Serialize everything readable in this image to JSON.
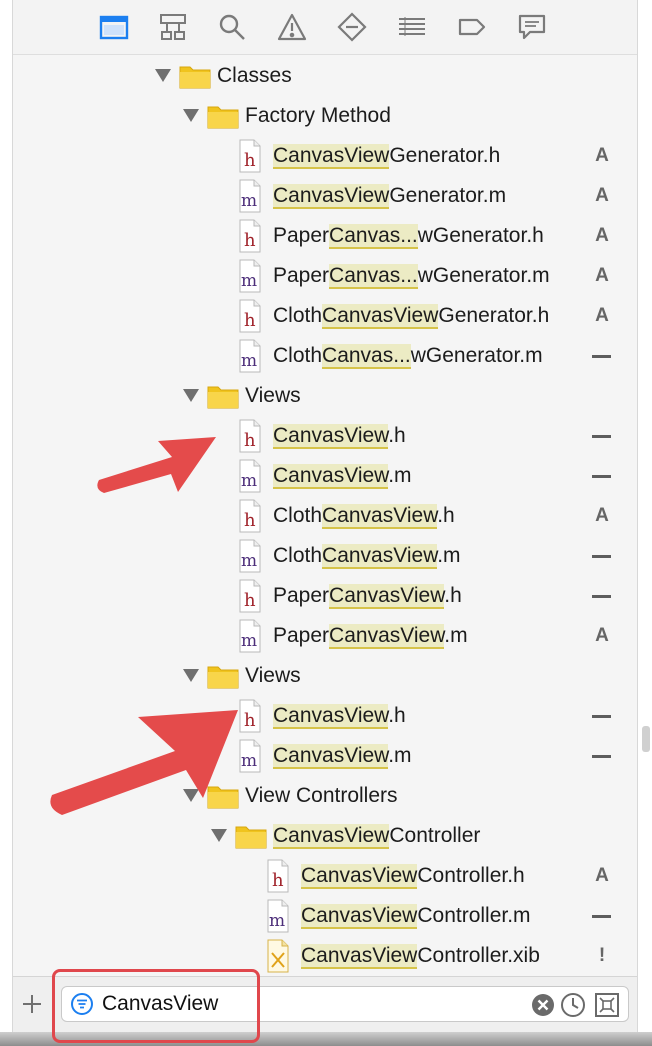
{
  "toolbar": {
    "icons": [
      "folder-icon",
      "hierarchy-icon",
      "search-icon",
      "warning-icon",
      "test-diamond-icon",
      "list-icon",
      "tag-icon",
      "comment-icon"
    ]
  },
  "tree": [
    {
      "kind": "folder",
      "label": "Classes"
    },
    {
      "kind": "folder",
      "label": "Factory Method"
    },
    {
      "kind": "file",
      "type": "h",
      "pre": "",
      "match": "CanvasView",
      "post": "Generator.h",
      "status": "A"
    },
    {
      "kind": "file",
      "type": "m",
      "pre": "",
      "match": "CanvasView",
      "post": "Generator.m",
      "status": "A"
    },
    {
      "kind": "file",
      "type": "h",
      "pre": "Paper",
      "match": "Canvas...",
      "post": "wGenerator.h",
      "status": "A"
    },
    {
      "kind": "file",
      "type": "m",
      "pre": "Paper",
      "match": "Canvas...",
      "post": "wGenerator.m",
      "status": "A"
    },
    {
      "kind": "file",
      "type": "h",
      "pre": "Cloth",
      "match": "CanvasView",
      "post": "Generator.h",
      "status": "A"
    },
    {
      "kind": "file",
      "type": "m",
      "pre": "Cloth",
      "match": "Canvas...",
      "post": "wGenerator.m",
      "status": "—"
    },
    {
      "kind": "folder",
      "label": "Views"
    },
    {
      "kind": "file",
      "type": "h",
      "pre": "",
      "match": "CanvasView",
      "post": ".h",
      "status": "—"
    },
    {
      "kind": "file",
      "type": "m",
      "pre": "",
      "match": "CanvasView",
      "post": ".m",
      "status": "—"
    },
    {
      "kind": "file",
      "type": "h",
      "pre": "Cloth",
      "match": "CanvasView",
      "post": ".h",
      "status": "A"
    },
    {
      "kind": "file",
      "type": "m",
      "pre": "Cloth",
      "match": "CanvasView",
      "post": ".m",
      "status": "—"
    },
    {
      "kind": "file",
      "type": "h",
      "pre": "Paper",
      "match": "CanvasView",
      "post": ".h",
      "status": "—"
    },
    {
      "kind": "file",
      "type": "m",
      "pre": "Paper",
      "match": "CanvasView",
      "post": ".m",
      "status": "A"
    },
    {
      "kind": "folder",
      "label": "Views"
    },
    {
      "kind": "file",
      "type": "h",
      "pre": "",
      "match": "CanvasView",
      "post": ".h",
      "status": "—"
    },
    {
      "kind": "file",
      "type": "m",
      "pre": "",
      "match": "CanvasView",
      "post": ".m",
      "status": "—"
    },
    {
      "kind": "folder",
      "label": "View Controllers"
    },
    {
      "kind": "folder",
      "pre": "",
      "match": "CanvasView",
      "post": "Controller"
    },
    {
      "kind": "file",
      "type": "h",
      "pre": "",
      "match": "CanvasView",
      "post": "Controller.h",
      "status": "A"
    },
    {
      "kind": "file",
      "type": "m",
      "pre": "",
      "match": "CanvasView",
      "post": "Controller.m",
      "status": "—"
    },
    {
      "kind": "file",
      "type": "xib",
      "pre": "",
      "match": "CanvasView",
      "post": "Controller.xib",
      "status": "!"
    }
  ],
  "filter": {
    "value": "CanvasView",
    "buttons": [
      "clear-filter-icon",
      "recent-files-icon",
      "source-control-filter-icon"
    ]
  },
  "colors": {
    "highlight": "#ecebc4",
    "highlight_underline": "#d6c34a",
    "annotation_red": "#e0474c",
    "accent_blue": "#1c7ff0"
  }
}
